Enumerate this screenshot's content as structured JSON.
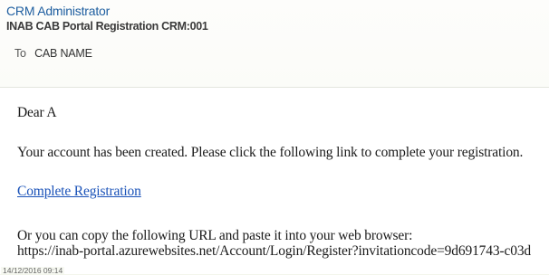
{
  "email": {
    "sender": "CRM Administrator",
    "subject": "INAB CAB Portal Registration CRM:001",
    "to_label": "To",
    "to_value": "CAB NAME",
    "greeting": "Dear A",
    "message": "Your account has been created. Please click the following link to complete your registration.",
    "link_label": "Complete Registration",
    "copy_instruction": "Or you can copy the following URL and paste it into your web browser:",
    "url": "https://inab-portal.azurewebsites.net/Account/Login/Register?invitationcode=9d691743-c03d",
    "timestamp": "14/12/2016 09:14"
  }
}
